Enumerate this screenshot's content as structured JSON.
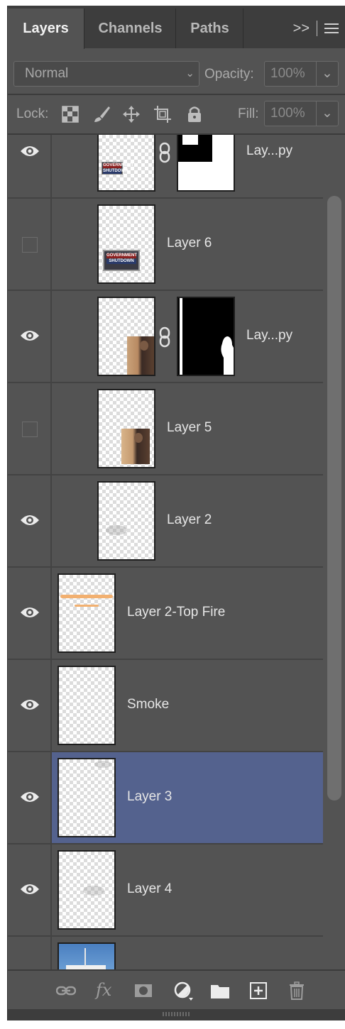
{
  "tabs": [
    {
      "label": "Layers",
      "active": true
    },
    {
      "label": "Channels",
      "active": false
    },
    {
      "label": "Paths",
      "active": false
    }
  ],
  "tab_overflow_glyph": ">>",
  "blend": {
    "mode": "Normal",
    "opacity_label": "Opacity:",
    "opacity_value": "100%"
  },
  "lock": {
    "label": "Lock:",
    "fill_label": "Fill:",
    "fill_value": "100%",
    "icons": [
      "lock-transparent-pixels-icon",
      "lock-image-pixels-icon",
      "lock-position-icon",
      "lock-artboard-icon",
      "lock-all-icon"
    ]
  },
  "layers": [
    {
      "name": "Lay...py",
      "visible": true,
      "clipped": true,
      "has_mask": true,
      "thumb": "government-sign",
      "thumb_text": [
        "GOVERNMENT",
        "SHUTDOWN"
      ]
    },
    {
      "name": "Layer 6",
      "visible": false,
      "clipped": true,
      "has_mask": false,
      "thumb": "government-sign",
      "thumb_text": [
        "GOVERNMENT",
        "SHUTDOWN"
      ]
    },
    {
      "name": "Lay...py",
      "visible": true,
      "clipped": true,
      "has_mask": true,
      "thumb": "person-photo"
    },
    {
      "name": "Layer 5",
      "visible": false,
      "clipped": true,
      "has_mask": false,
      "thumb": "person-photo"
    },
    {
      "name": "Layer 2",
      "visible": true,
      "clipped": true,
      "has_mask": false,
      "thumb": "faint-smoke"
    },
    {
      "name": "Layer 2-Top Fire",
      "visible": true,
      "clipped": false,
      "has_mask": false,
      "thumb": "fire"
    },
    {
      "name": "Smoke",
      "visible": true,
      "clipped": false,
      "has_mask": false,
      "thumb": "empty"
    },
    {
      "name": "Layer 3",
      "visible": true,
      "clipped": false,
      "has_mask": false,
      "thumb": "faint-smoke",
      "selected": true
    },
    {
      "name": "Layer 4",
      "visible": true,
      "clipped": false,
      "has_mask": false,
      "thumb": "faint-smoke"
    },
    {
      "name": "",
      "visible": false,
      "clipped": false,
      "has_mask": false,
      "thumb": "sky-photo"
    }
  ],
  "bottom_icons": [
    "link-layers-icon",
    "fx-icon",
    "add-mask-icon",
    "adjustment-layer-icon",
    "new-group-icon",
    "new-layer-icon",
    "delete-layer-icon"
  ],
  "bottom_fx_text": "fx",
  "colors": {
    "panel": "#535353",
    "selected_row": "#54628e",
    "tabbar": "#3d3d3d"
  }
}
